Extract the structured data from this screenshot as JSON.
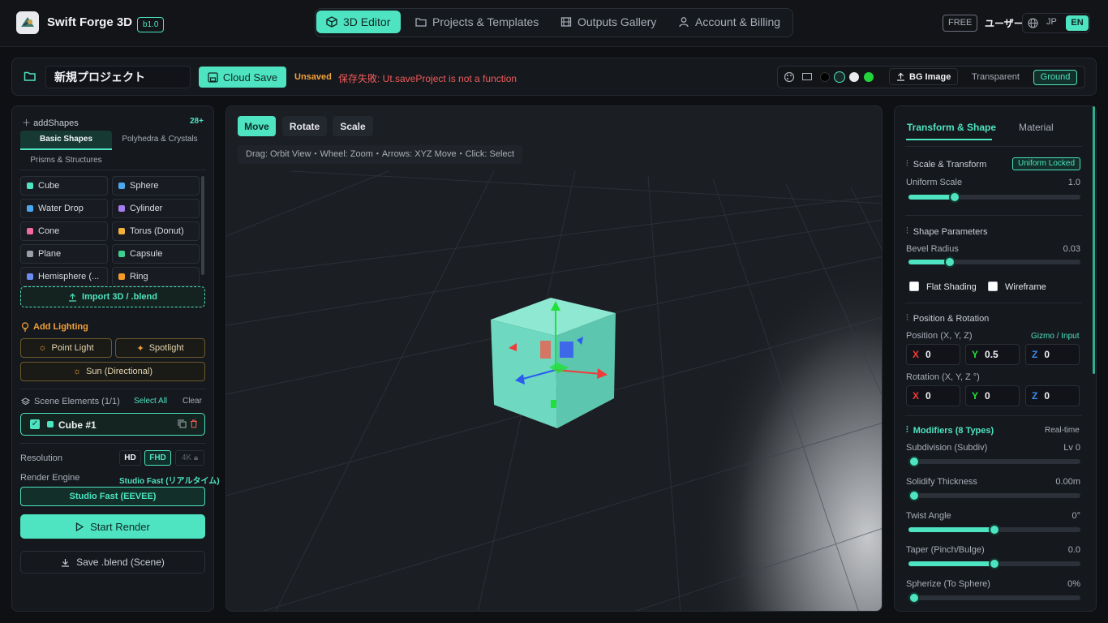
{
  "header": {
    "brand": "Swift Forge 3D",
    "version": "b1.0",
    "nav": [
      {
        "label": "3D Editor",
        "active": true
      },
      {
        "label": "Projects & Templates"
      },
      {
        "label": "Outputs Gallery"
      },
      {
        "label": "Account & Billing"
      }
    ],
    "plan": "FREE",
    "user": "ユーザー",
    "lang_jp": "JP",
    "lang_en": "EN"
  },
  "toolbar": {
    "project_name": "新規プロジェクト",
    "cloud_save": "Cloud Save",
    "unsaved": "Unsaved",
    "error": "保存失敗: Ut.saveProject is not a function",
    "bg_swatches": [
      "#000000",
      "#1a2a28",
      "#e8eaee",
      "#22d33a"
    ],
    "bg_image": "BG Image",
    "transparent": "Transparent",
    "ground": "Ground"
  },
  "left": {
    "add_shapes": "addShapes",
    "shape_count": "28+",
    "tabs": [
      "Basic Shapes",
      "Polyhedra & Crystals",
      "Prisms & Structures"
    ],
    "shapes": [
      {
        "label": "Cube",
        "color": "#4ee3c1"
      },
      {
        "label": "Sphere",
        "color": "#4aa7f0"
      },
      {
        "label": "Water Drop",
        "color": "#4aa7f0"
      },
      {
        "label": "Cylinder",
        "color": "#a57cf0"
      },
      {
        "label": "Cone",
        "color": "#f06aa0"
      },
      {
        "label": "Torus (Donut)",
        "color": "#f3b13b"
      },
      {
        "label": "Plane",
        "color": "#9aa0a8"
      },
      {
        "label": "Capsule",
        "color": "#3ecf8e"
      },
      {
        "label": "Hemisphere (...",
        "color": "#6a8cf0"
      },
      {
        "label": "Ring",
        "color": "#f39a2b"
      }
    ],
    "import": "Import 3D / .blend",
    "add_lighting": "Add Lighting",
    "point_light": "Point Light",
    "spotlight": "Spotlight",
    "sun": "Sun (Directional)",
    "scene_elements": "Scene Elements (1/1)",
    "select_all": "Select All",
    "clear": "Clear",
    "element": "Cube #1",
    "resolution_label": "Resolution",
    "res_hd": "HD",
    "res_fhd": "FHD",
    "res_4k": "4K",
    "engine_label": "Render Engine",
    "engine_value": "Studio Fast (リアルタイム)",
    "engine_button": "Studio Fast (EEVEE)",
    "start_render": "Start Render",
    "save_blend": "Save .blend (Scene)"
  },
  "viewport": {
    "move": "Move",
    "rotate": "Rotate",
    "scale": "Scale",
    "hint": "Drag: Orbit View・Wheel: Zoom・Arrows: XYZ Move・Click: Select"
  },
  "right": {
    "tab_transform": "Transform & Shape",
    "tab_material": "Material",
    "scale_transform": "Scale & Transform",
    "uniform_locked": "Uniform Locked",
    "uniform_scale": "Uniform Scale",
    "uniform_scale_val": "1.0",
    "shape_params": "Shape Parameters",
    "bevel_radius": "Bevel Radius",
    "bevel_val": "0.03",
    "flat_shading": "Flat Shading",
    "wireframe": "Wireframe",
    "pos_rot": "Position & Rotation",
    "position_label": "Position (X, Y, Z)",
    "gizmo_input": "Gizmo / Input",
    "pos": {
      "x": "0",
      "y": "0.5",
      "z": "0"
    },
    "rotation_label": "Rotation (X, Y, Z °)",
    "rot": {
      "x": "0",
      "y": "0",
      "z": "0"
    },
    "axis_x": "X",
    "axis_y": "Y",
    "axis_z": "Z",
    "modifiers": "Modifiers (8 Types)",
    "realtime": "Real-time",
    "subdiv": "Subdivision (Subdiv)",
    "subdiv_val": "Lv 0",
    "solidify": "Solidify Thickness",
    "solidify_val": "0.00m",
    "twist": "Twist Angle",
    "twist_val": "0°",
    "taper": "Taper (Pinch/Bulge)",
    "taper_val": "0.0",
    "spherize": "Spherize (To Sphere)",
    "spherize_val": "0%"
  },
  "sliders": {
    "uniform_scale": 0.25,
    "bevel": 0.22,
    "subdiv": 0.0,
    "solidify": 0.0,
    "twist": 0.5,
    "taper": 0.5,
    "spherize": 0.0
  }
}
